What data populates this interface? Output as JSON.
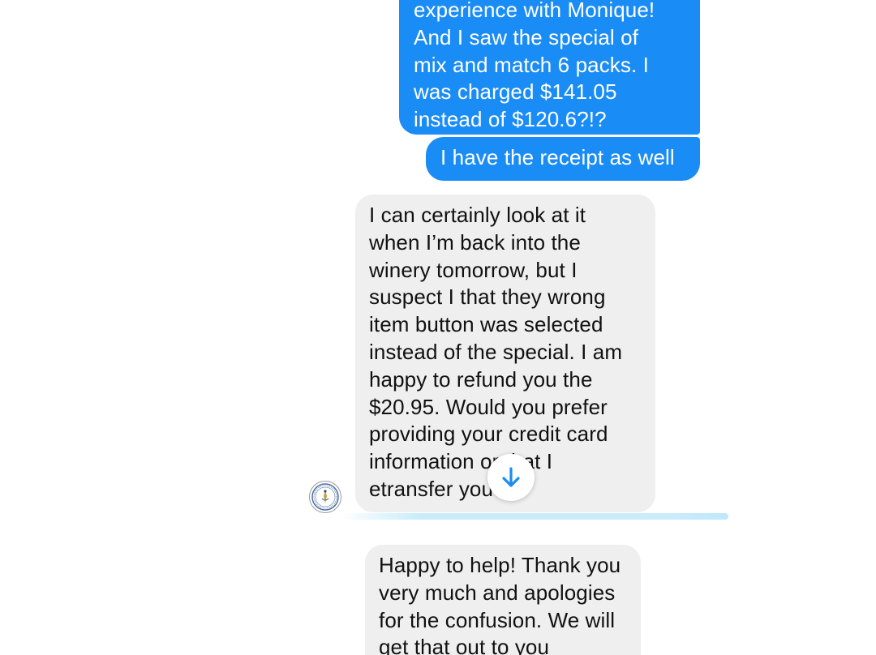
{
  "conversation": {
    "messages": [
      {
        "sender": "outgoing",
        "text": "experience with Monique!\nAnd I saw the special of\nmix and match 6 packs. I\nwas charged $141.05\ninstead of $120.6?!?"
      },
      {
        "sender": "outgoing",
        "text": "I have the receipt as well"
      },
      {
        "sender": "incoming",
        "text": "I can certainly look at it\nwhen I’m back into the\nwinery tomorrow, but I\nsuspect I that they wrong\nitem button was selected\ninstead of the special. I am\nhappy to refund you the\n$20.95. Would you prefer\nproviding your credit card\ninformation or that I\netransfer you?"
      },
      {
        "sender": "incoming",
        "text": "Happy to help! Thank you\nvery much and apologies\nfor the confusion. We will\nget that out to you"
      }
    ]
  },
  "colors": {
    "outgoing_bubble": "#1a8cf5",
    "incoming_bubble": "#efefef",
    "scroll_arrow": "#1a8cf5"
  },
  "icons": {
    "avatar": "winery-logo-avatar",
    "scroll_button": "arrow-down-icon"
  }
}
